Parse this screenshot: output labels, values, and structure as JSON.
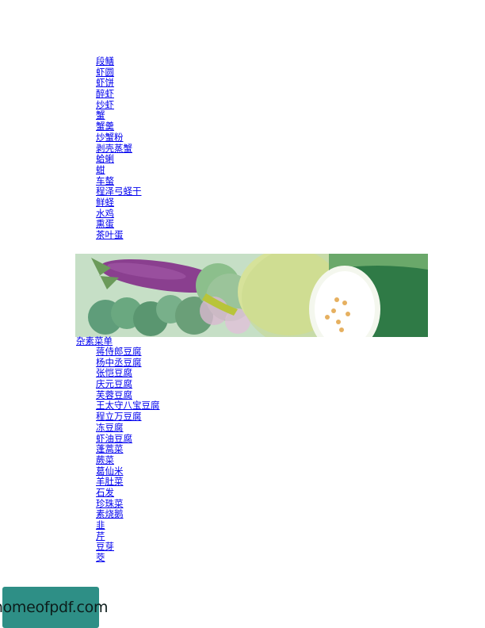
{
  "list_top": {
    "items": [
      "段鳝",
      "虾圆",
      "虾饼",
      "醉虾",
      "炒虾",
      "蟹",
      "蟹羹",
      "炒蟹粉",
      "剥壳蒸蟹",
      "蛤蜊",
      "蚶",
      "车螯",
      "程泽弓蛏干",
      "鲜蛏",
      "水鸡",
      "熏蛋",
      "茶叶蛋"
    ]
  },
  "section": {
    "title": "杂素菜单",
    "items": [
      "蒋侍郎豆腐",
      "杨中丞豆腐",
      "张恺豆腐",
      "庆元豆腐",
      "芙蓉豆腐",
      "王太守八宝豆腐",
      "程立万豆腐",
      "冻豆腐",
      "虾油豆腐",
      "蓬蒿菜",
      "蕨菜",
      "葛仙米",
      "羊肚菜",
      "石发",
      "珍珠菜",
      "素烧鹅",
      "韭",
      "芹",
      "豆芽",
      "茭"
    ]
  },
  "logo": {
    "text": "homeofpdf.com"
  },
  "colors": {
    "link": "#0000ee",
    "logo_bg": "#2e8f86"
  }
}
